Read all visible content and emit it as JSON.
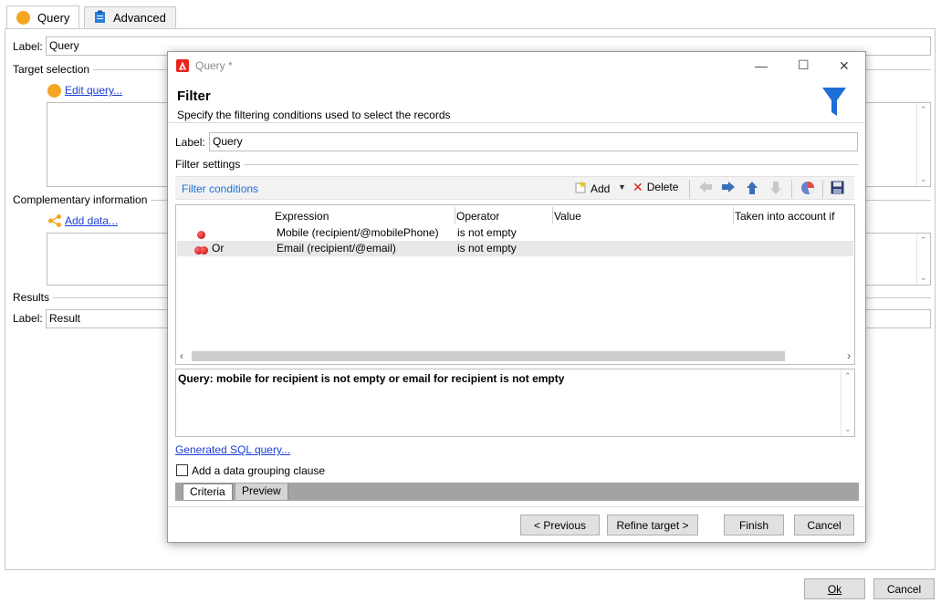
{
  "tabs": [
    {
      "label": "Query",
      "icon": "orange-circle-icon",
      "active": true
    },
    {
      "label": "Advanced",
      "icon": "clipboard-icon",
      "active": false
    }
  ],
  "main": {
    "label_caption": "Label:",
    "label_value": "Query",
    "target_selection_title": "Target selection",
    "edit_query_link": "Edit query...",
    "complementary_title": "Complementary information",
    "add_data_link": "Add data...",
    "results_title": "Results",
    "results_label_caption": "Label:",
    "results_label_value": "Result",
    "ok_button": "Ok",
    "cancel_button": "Cancel"
  },
  "dialog": {
    "window_title": "Query *",
    "heading": "Filter",
    "subheading": "Specify the filtering conditions used to select the records",
    "label_caption": "Label:",
    "label_value": "Query",
    "filter_settings_title": "Filter settings",
    "filter_conditions_label": "Filter conditions",
    "add_button": "Add",
    "delete_button": "Delete",
    "columns": [
      "Expression",
      "Operator",
      "Value",
      "Taken into account if"
    ],
    "rows": [
      {
        "prefix": "",
        "expression": "Mobile (recipient/@mobilePhone)",
        "operator": "is not empty",
        "value": "",
        "condition": ""
      },
      {
        "prefix": "Or",
        "expression": "Email (recipient/@email)",
        "operator": "is not empty",
        "value": "",
        "condition": ""
      }
    ],
    "query_text": "Query: mobile for recipient is not empty or email for recipient is not empty",
    "sql_link": "Generated SQL query...",
    "grouping_checkbox_label": "Add a data grouping clause",
    "grouping_checked": false,
    "bottom_tabs": [
      "Criteria",
      "Preview"
    ],
    "previous_button": "< Previous",
    "refine_button": "Refine target >",
    "finish_button": "Finish",
    "cancel_button": "Cancel"
  },
  "colors": {
    "accent_blue": "#1d6fd6",
    "link_blue": "#1a3fd6",
    "orange": "#f5a623",
    "adobe_red": "#e8261d"
  }
}
